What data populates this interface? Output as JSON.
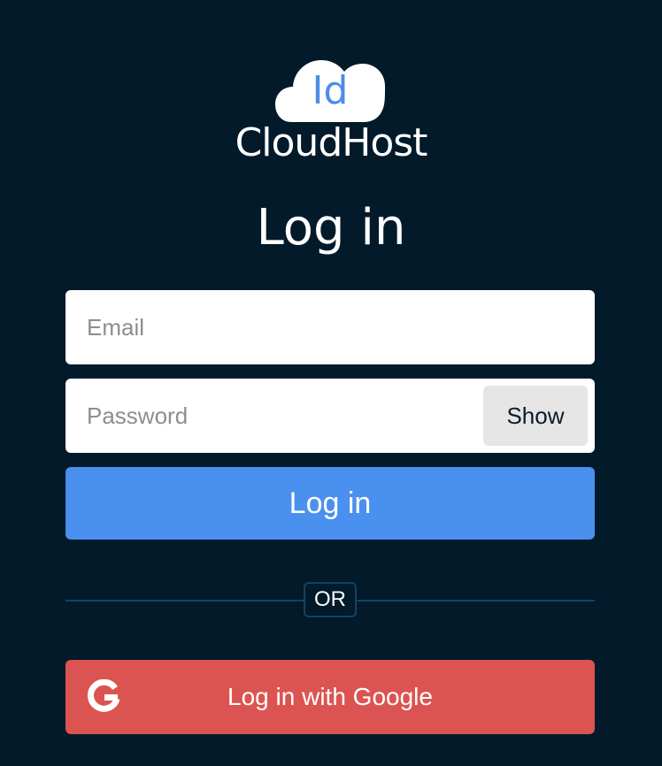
{
  "brand": {
    "cloud_text": "Id",
    "name": "CloudHost",
    "accent_color": "#4b8de8"
  },
  "page": {
    "title": "Log in",
    "background_color": "#021a2a"
  },
  "form": {
    "email_placeholder": "Email",
    "email_value": "",
    "password_placeholder": "Password",
    "password_value": "",
    "show_label": "Show",
    "submit_label": "Log in",
    "submit_color": "#4a90ee"
  },
  "divider": {
    "label": "OR"
  },
  "google": {
    "label": "Log in with Google",
    "icon": "google-g-icon",
    "color": "#db5451"
  }
}
